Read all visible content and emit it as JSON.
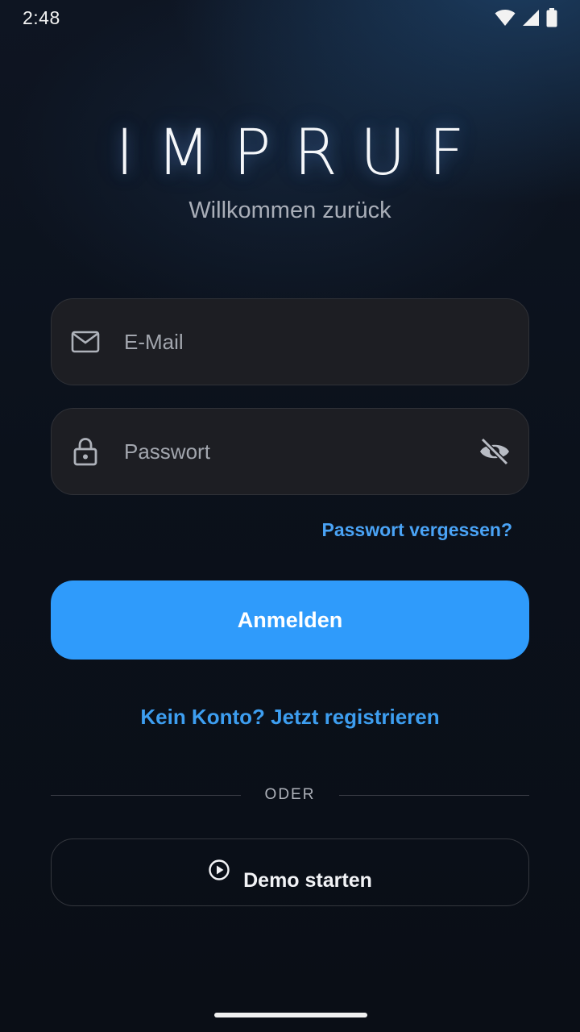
{
  "status_bar": {
    "time": "2:48",
    "icons": [
      "wifi-icon",
      "cellular-signal-icon",
      "battery-icon"
    ]
  },
  "header": {
    "logo": "IMPRUF",
    "subtitle": "Willkommen zurück"
  },
  "form": {
    "email": {
      "placeholder": "E-Mail",
      "value": "",
      "icon": "mail-icon"
    },
    "password": {
      "placeholder": "Passwort",
      "value": "",
      "icon": "lock-icon",
      "toggle_icon": "eye-off-icon"
    },
    "forgot_link": "Passwort vergessen?",
    "submit_label": "Anmelden"
  },
  "register_link": "Kein Konto? Jetzt registrieren",
  "divider_label": "ODER",
  "demo": {
    "label": "Demo starten",
    "icon": "play-circle-icon"
  },
  "colors": {
    "accent": "#2f9bfb",
    "link": "#4aa3f5",
    "field_bg": "#1d1e23",
    "background": "#0b111b"
  }
}
